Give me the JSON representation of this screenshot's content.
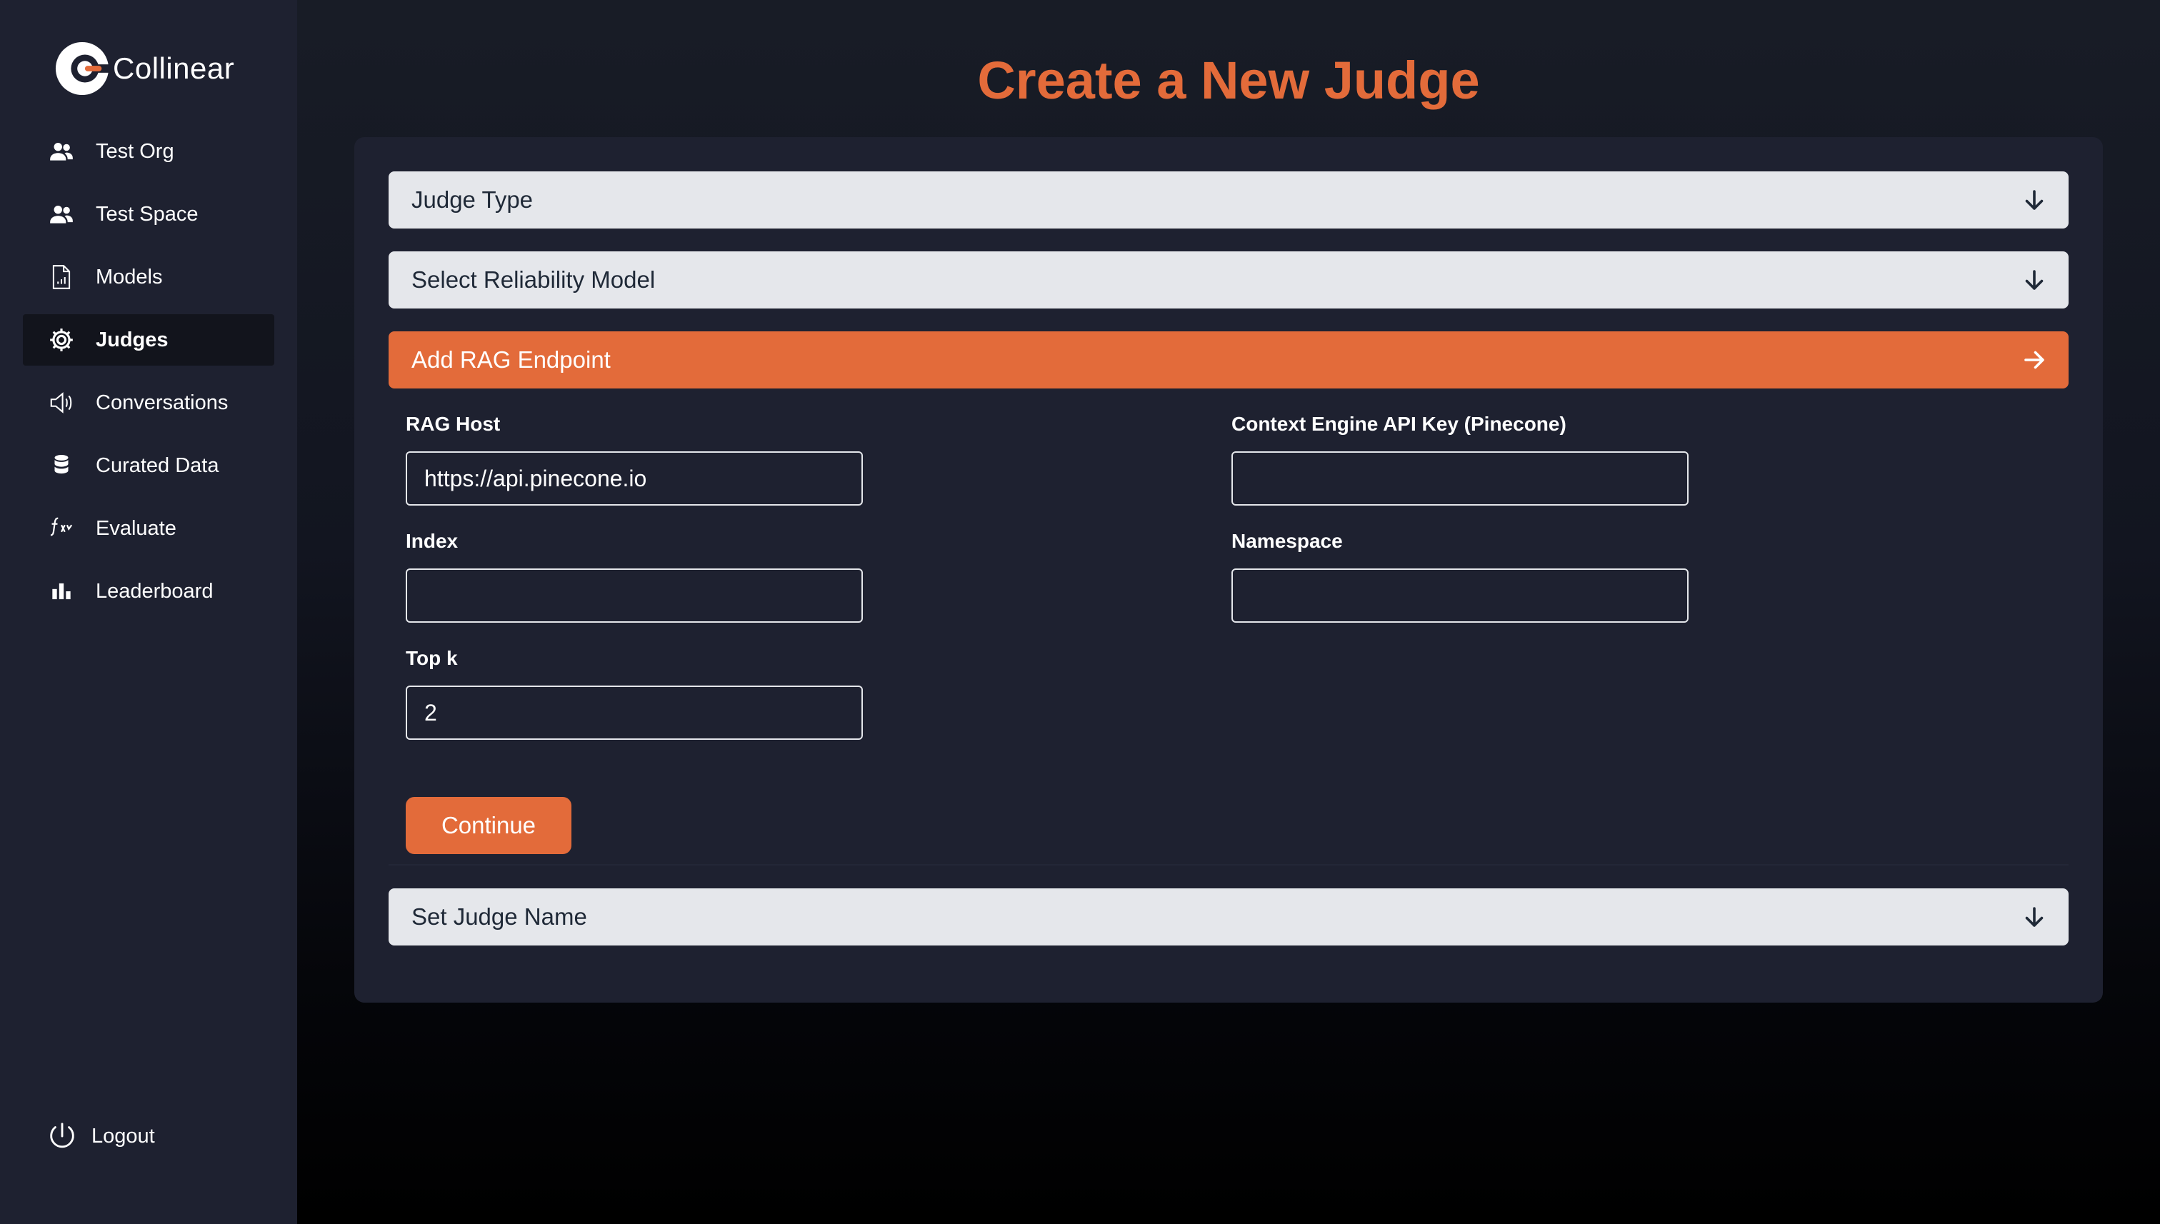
{
  "brand": {
    "name": "Collinear",
    "accent": "#e36b3a"
  },
  "sidebar": {
    "items": [
      {
        "label": "Test Org",
        "icon": "users-icon",
        "active": false
      },
      {
        "label": "Test Space",
        "icon": "users-icon",
        "active": false
      },
      {
        "label": "Models",
        "icon": "document-chart-icon",
        "active": false
      },
      {
        "label": "Judges",
        "icon": "gear-icon",
        "active": true
      },
      {
        "label": "Conversations",
        "icon": "speaker-icon",
        "active": false
      },
      {
        "label": "Curated Data",
        "icon": "database-icon",
        "active": false
      },
      {
        "label": "Evaluate",
        "icon": "function-icon",
        "active": false
      },
      {
        "label": "Leaderboard",
        "icon": "bar-chart-icon",
        "active": false
      }
    ],
    "logout_label": "Logout"
  },
  "main": {
    "title": "Create a New Judge",
    "steps": {
      "judge_type": "Judge Type",
      "reliability_model": "Select Reliability Model",
      "rag_endpoint": "Add RAG Endpoint",
      "judge_name": "Set Judge Name"
    },
    "form": {
      "rag_host_label": "RAG Host",
      "rag_host_value": "https://api.pinecone.io",
      "api_key_label": "Context Engine API Key (Pinecone)",
      "api_key_value": "",
      "index_label": "Index",
      "index_value": "",
      "namespace_label": "Namespace",
      "namespace_value": "",
      "top_k_label": "Top k",
      "top_k_value": "2",
      "continue_label": "Continue"
    }
  }
}
